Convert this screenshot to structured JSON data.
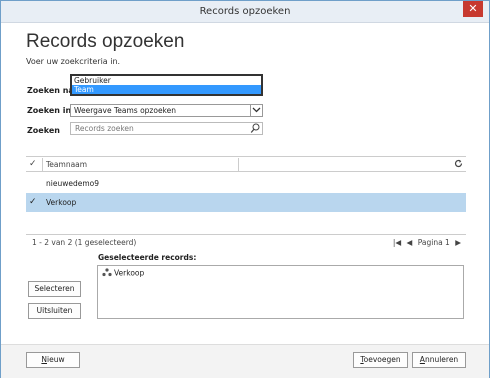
{
  "window": {
    "title": "Records opzoeken",
    "close_glyph": "✕"
  },
  "header": {
    "title": "Records opzoeken",
    "subtitle": "Voer uw zoekcriteria in."
  },
  "form": {
    "zoeken_naar_label": "Zoeken naar",
    "zoeken_naar_options": [
      "Gebruiker",
      "Team"
    ],
    "zoeken_naar_selected": "Team",
    "zoeken_in_label": "Zoeken in",
    "zoeken_in_value": "Weergave Teams opzoeken",
    "zoeken_label": "Zoeken",
    "zoeken_placeholder": "Records zoeken"
  },
  "grid": {
    "columns": [
      "Teamnaam"
    ],
    "rows": [
      {
        "name": "nieuwedemo9",
        "selected": false
      },
      {
        "name": "Verkoop",
        "selected": true
      }
    ]
  },
  "pager": {
    "count_text": "1 - 2  van 2 (1 geselecteerd)",
    "page_text": "Pagina 1"
  },
  "selected": {
    "label": "Geselecteerde records:",
    "items": [
      "Verkoop"
    ]
  },
  "buttons": {
    "selecteren": "Selecteren",
    "uitsluiten": "Uitsluiten",
    "nieuw": "Nieuw",
    "toevoegen": "Toevoegen",
    "annuleren": "Annuleren"
  },
  "colors": {
    "selection_row": "#b9d6ee",
    "dropdown_highlight": "#3399ff",
    "close_button": "#c7392f"
  }
}
